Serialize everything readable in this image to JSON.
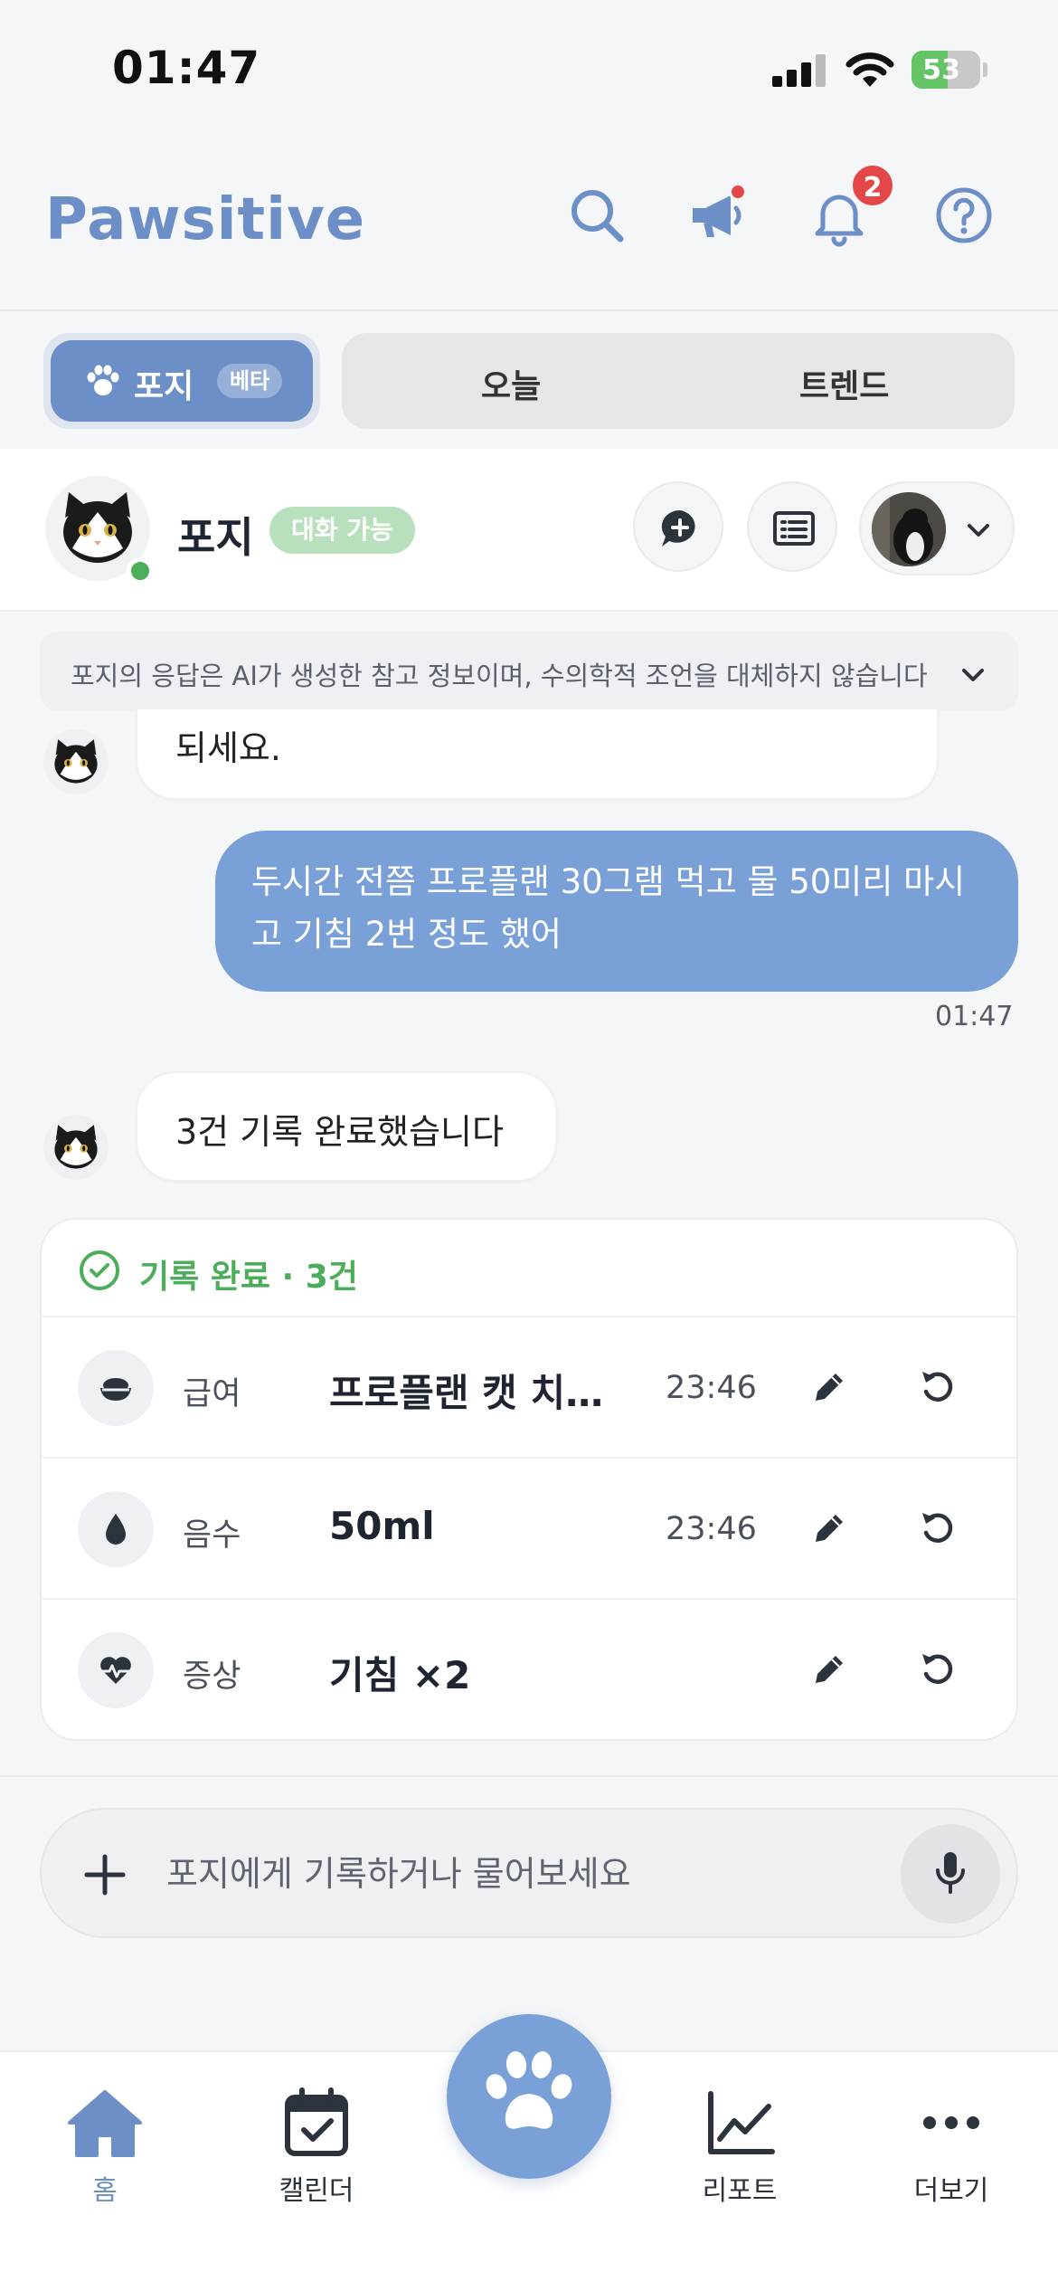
{
  "status": {
    "time": "01:47",
    "battery": "53"
  },
  "header": {
    "brand": "Pawsitive",
    "notification_count": "2"
  },
  "tabs": {
    "active_label": "포지",
    "beta_label": "베타",
    "today_label": "오늘",
    "trend_label": "트렌드"
  },
  "pet": {
    "name": "포지",
    "status_pill": "대화 가능"
  },
  "disclaimer": "포지의 응답은 AI가 생성한 참고 정보이며, 수의학적 조언을 대체하지 않습니다",
  "chat": {
    "partial_bot_text": "되세요.",
    "user_message": "두시간 전쯤 프로플랜 30그램 먹고 물 50미리 마시고 기침 2번 정도 했어",
    "user_time": "01:47",
    "bot_reply": "3건 기록 완료했습니다"
  },
  "record_card": {
    "title": "기록 완료 · 3건",
    "rows": [
      {
        "icon": "food-bowl-icon",
        "category": "급여",
        "value": "프로플랜 캣 치킨…",
        "time": "23:46"
      },
      {
        "icon": "water-drop-icon",
        "category": "음수",
        "value": "50ml",
        "time": "23:46"
      },
      {
        "icon": "heartbeat-icon",
        "category": "증상",
        "value": "기침 ×2",
        "time": ""
      }
    ]
  },
  "input": {
    "placeholder": "포지에게 기록하거나 물어보세요"
  },
  "nav": {
    "home": "홈",
    "calendar": "캘린더",
    "report": "리포트",
    "more": "더보기"
  },
  "colors": {
    "brand": "#6c8fc8",
    "user_bubble": "#7aa0d8",
    "success": "#4cae5a",
    "alert": "#e44747"
  }
}
